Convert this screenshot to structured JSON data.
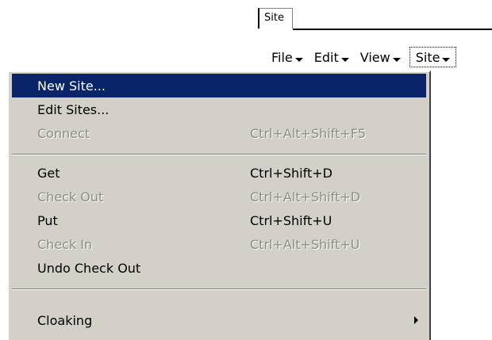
{
  "panel": {
    "tab_label": "Site"
  },
  "menubar": {
    "items": [
      {
        "label": "File"
      },
      {
        "label": "Edit"
      },
      {
        "label": "View"
      },
      {
        "label": "Site"
      }
    ]
  },
  "menu": {
    "items": [
      {
        "label": "New Site...",
        "shortcut": ""
      },
      {
        "label": "Edit Sites...",
        "shortcut": ""
      },
      {
        "label": "Connect",
        "shortcut": "Ctrl+Alt+Shift+F5"
      },
      {
        "label": "Get",
        "shortcut": "Ctrl+Shift+D"
      },
      {
        "label": "Check Out",
        "shortcut": "Ctrl+Alt+Shift+D"
      },
      {
        "label": "Put",
        "shortcut": "Ctrl+Shift+U"
      },
      {
        "label": "Check In",
        "shortcut": "Ctrl+Alt+Shift+U"
      },
      {
        "label": "Undo Check Out",
        "shortcut": ""
      },
      {
        "label": "Cloaking",
        "shortcut": ""
      }
    ]
  },
  "colors": {
    "highlight": "#0a246a",
    "menu_bg": "#d4d0c8",
    "disabled_text": "#8e8c86"
  }
}
